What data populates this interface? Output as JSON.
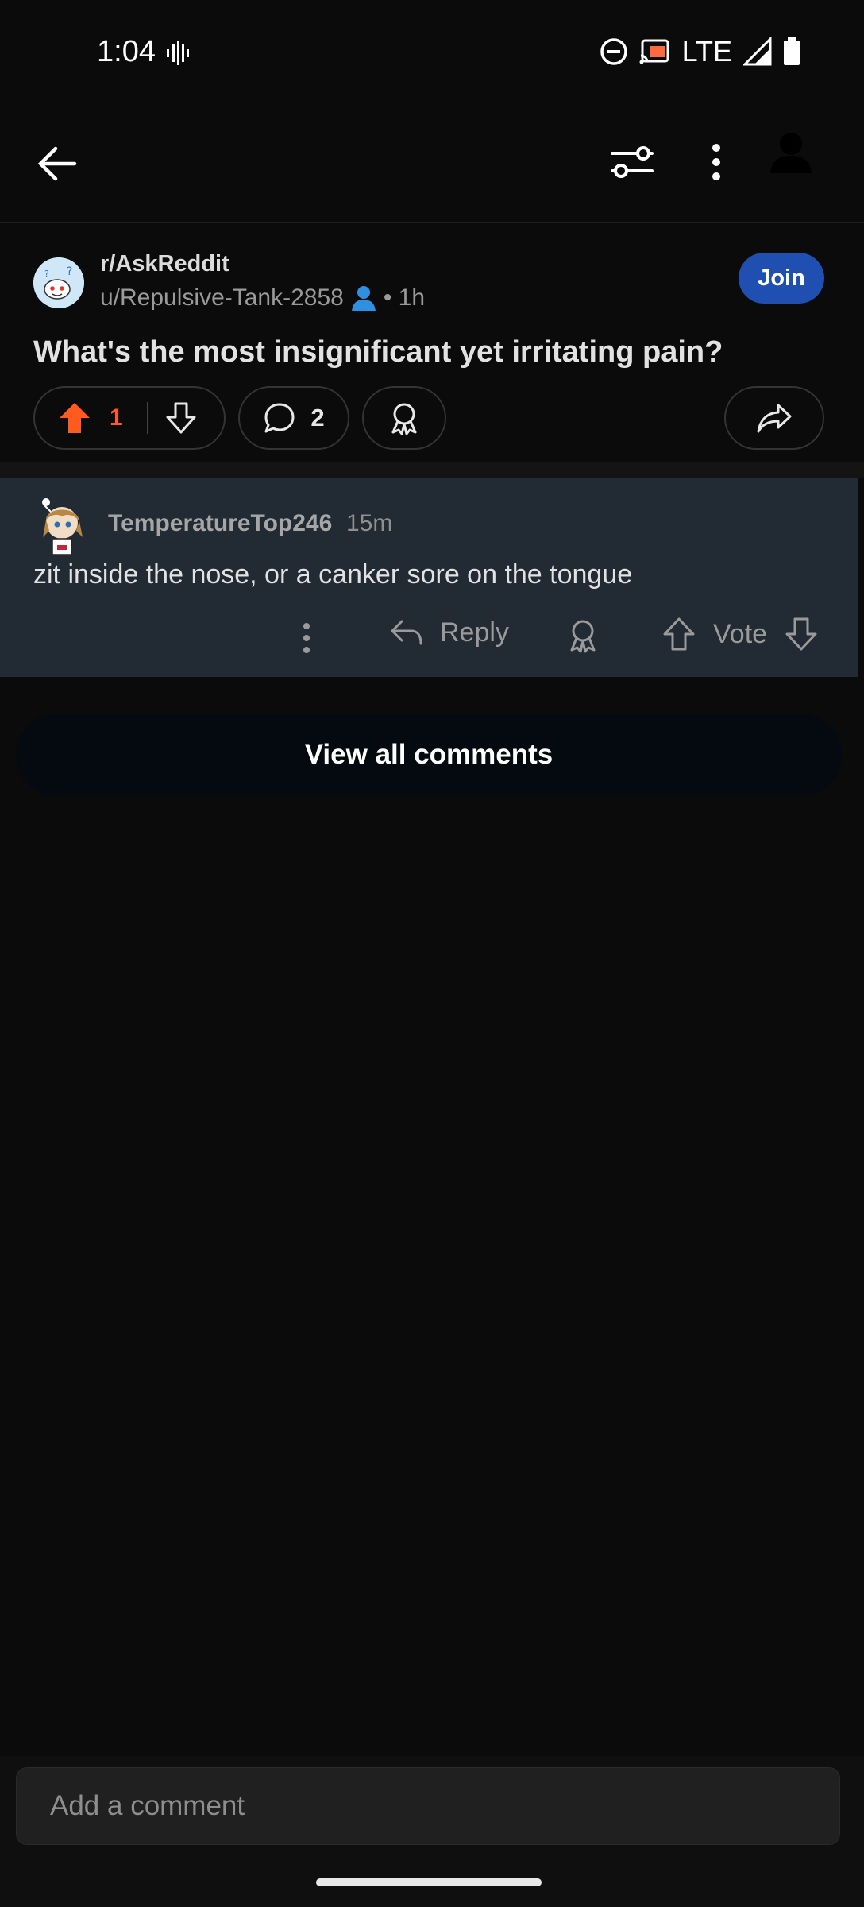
{
  "status": {
    "time": "1:04",
    "network": "LTE"
  },
  "post": {
    "subreddit": "r/AskReddit",
    "user": "u/Repulsive-Tank-2858",
    "age": "• 1h",
    "join_label": "Join",
    "title": "What's the most insignificant yet irritating pain?",
    "votes": "1",
    "comments": "2"
  },
  "comment": {
    "user": "TemperatureTop246",
    "time": "15m",
    "text": "zit inside the nose, or a canker sore on the tongue",
    "reply_label": "Reply",
    "vote_label": "Vote"
  },
  "view_all_label": "View all comments",
  "composer": {
    "placeholder": "Add a comment"
  },
  "colors": {
    "accent_upvote": "#ff5a1f",
    "join_button": "#1f4fb0",
    "comment_bg": "#222a33",
    "user_icon": "#2f8fe0"
  }
}
